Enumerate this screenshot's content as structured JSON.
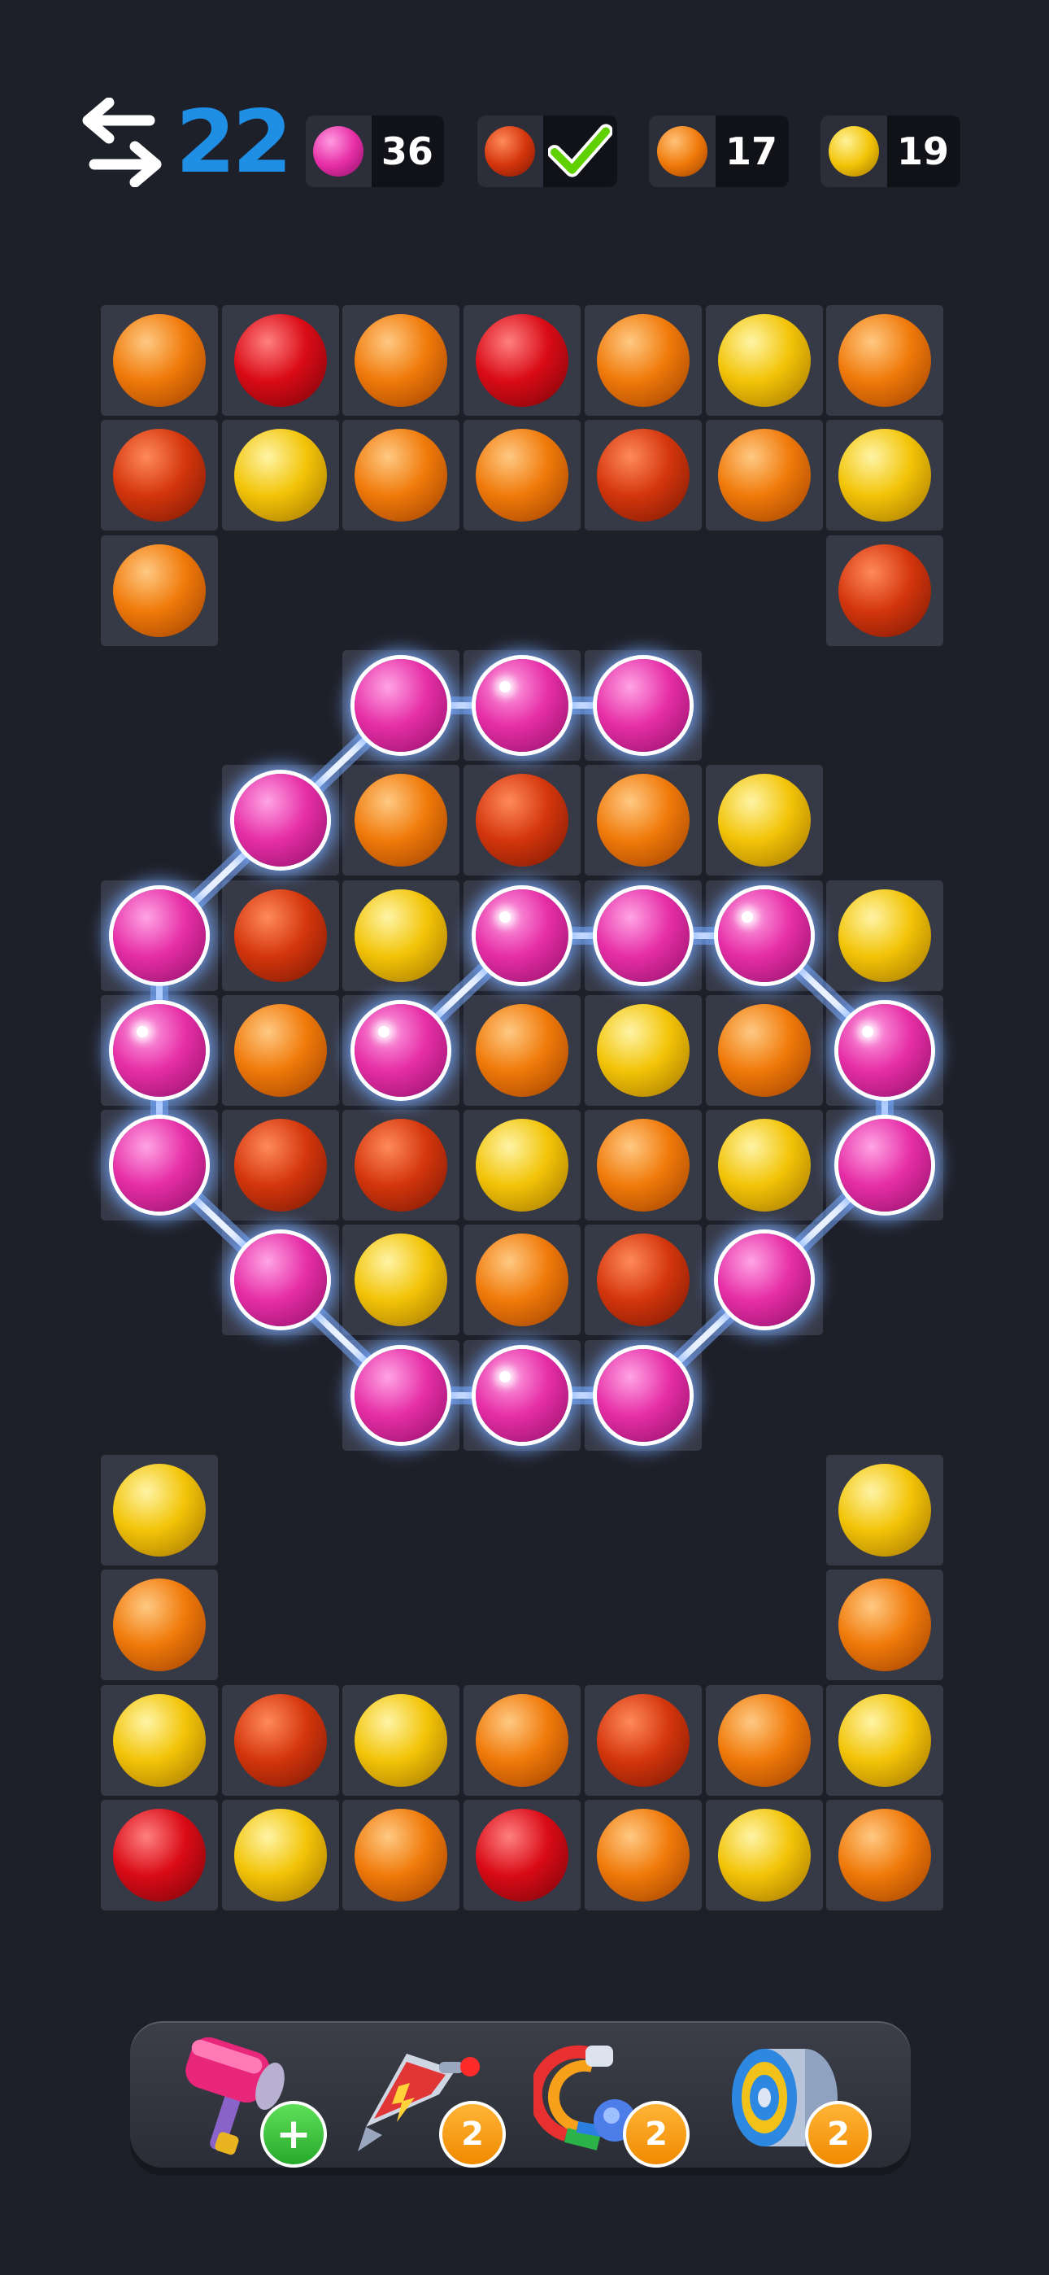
{
  "moves": {
    "count": "22"
  },
  "goals": [
    {
      "color": "pink",
      "count": "36",
      "done": false
    },
    {
      "color": "red",
      "count": "",
      "done": true
    },
    {
      "color": "orange",
      "count": "17",
      "done": false
    },
    {
      "color": "yellow",
      "count": "19",
      "done": false
    }
  ],
  "colors": {
    "pink": "#e62ea6",
    "red": "#d90b16",
    "redorange": "#d4360c",
    "orange": "#f07a0a",
    "yellow": "#f2c408",
    "check": "#5fd000",
    "moves": "#1f8fe6",
    "glow": "#7fb0ff"
  },
  "board": {
    "cols": 7,
    "rows": [
      [
        "O",
        "R",
        "O",
        "R",
        "O",
        "Y",
        "O"
      ],
      [
        "D",
        "Y",
        "O",
        "O",
        "D",
        "O",
        "Y"
      ],
      [
        "O",
        "",
        "",
        "",
        "",
        "",
        "D"
      ],
      [
        "",
        "",
        "P",
        "P",
        "P",
        "",
        ""
      ],
      [
        "",
        "P",
        "O",
        "D",
        "O",
        "Y",
        ""
      ],
      [
        "P",
        "D",
        "Y",
        "P",
        "P",
        "P",
        "Y"
      ],
      [
        "P",
        "O",
        "P",
        "O",
        "Y",
        "O",
        "P"
      ],
      [
        "P",
        "D",
        "D",
        "Y",
        "O",
        "Y",
        "P"
      ],
      [
        "",
        "P",
        "Y",
        "O",
        "D",
        "P",
        ""
      ],
      [
        "",
        "",
        "P",
        "P",
        "P",
        "",
        ""
      ],
      [
        "Y",
        "",
        "",
        "",
        "",
        "",
        "Y"
      ],
      [
        "O",
        "",
        "",
        "",
        "",
        "",
        "O"
      ],
      [
        "Y",
        "D",
        "Y",
        "O",
        "D",
        "O",
        "Y"
      ],
      [
        "R",
        "Y",
        "O",
        "R",
        "O",
        "Y",
        "O"
      ]
    ],
    "legend": {
      "O": "orange",
      "R": "red",
      "D": "redorange",
      "Y": "yellow",
      "P": "pink"
    }
  },
  "selection_path": [
    [
      9,
      2
    ],
    [
      9,
      3
    ],
    [
      9,
      4
    ],
    [
      8,
      5
    ],
    [
      7,
      6
    ],
    [
      6,
      6
    ],
    [
      5,
      5
    ],
    [
      5,
      4
    ],
    [
      5,
      3
    ],
    [
      6,
      2
    ],
    [
      3,
      2
    ],
    [
      3,
      3
    ],
    [
      3,
      4
    ],
    [
      4,
      1
    ],
    [
      5,
      0
    ],
    [
      6,
      0
    ],
    [
      7,
      0
    ],
    [
      8,
      1
    ]
  ],
  "selection_links": [
    [
      [
        3,
        2
      ],
      [
        3,
        3
      ]
    ],
    [
      [
        3,
        3
      ],
      [
        3,
        4
      ]
    ],
    [
      [
        3,
        2
      ],
      [
        4,
        1
      ]
    ],
    [
      [
        4,
        1
      ],
      [
        5,
        0
      ]
    ],
    [
      [
        5,
        0
      ],
      [
        6,
        0
      ]
    ],
    [
      [
        6,
        0
      ],
      [
        7,
        0
      ]
    ],
    [
      [
        7,
        0
      ],
      [
        8,
        1
      ]
    ],
    [
      [
        8,
        1
      ],
      [
        9,
        2
      ]
    ],
    [
      [
        9,
        2
      ],
      [
        9,
        3
      ]
    ],
    [
      [
        9,
        3
      ],
      [
        9,
        4
      ]
    ],
    [
      [
        9,
        4
      ],
      [
        8,
        5
      ]
    ],
    [
      [
        8,
        5
      ],
      [
        7,
        6
      ]
    ],
    [
      [
        7,
        6
      ],
      [
        6,
        6
      ]
    ],
    [
      [
        6,
        6
      ],
      [
        5,
        5
      ]
    ],
    [
      [
        5,
        5
      ],
      [
        5,
        4
      ]
    ],
    [
      [
        5,
        4
      ],
      [
        5,
        3
      ]
    ],
    [
      [
        5,
        3
      ],
      [
        6,
        2
      ]
    ]
  ],
  "tools": [
    {
      "name": "hammer-tool",
      "badge": "+"
    },
    {
      "name": "rocket-tool",
      "badge": "2"
    },
    {
      "name": "rainbow-magnet-tool",
      "badge": "2"
    },
    {
      "name": "roller-tool",
      "badge": "2"
    }
  ]
}
